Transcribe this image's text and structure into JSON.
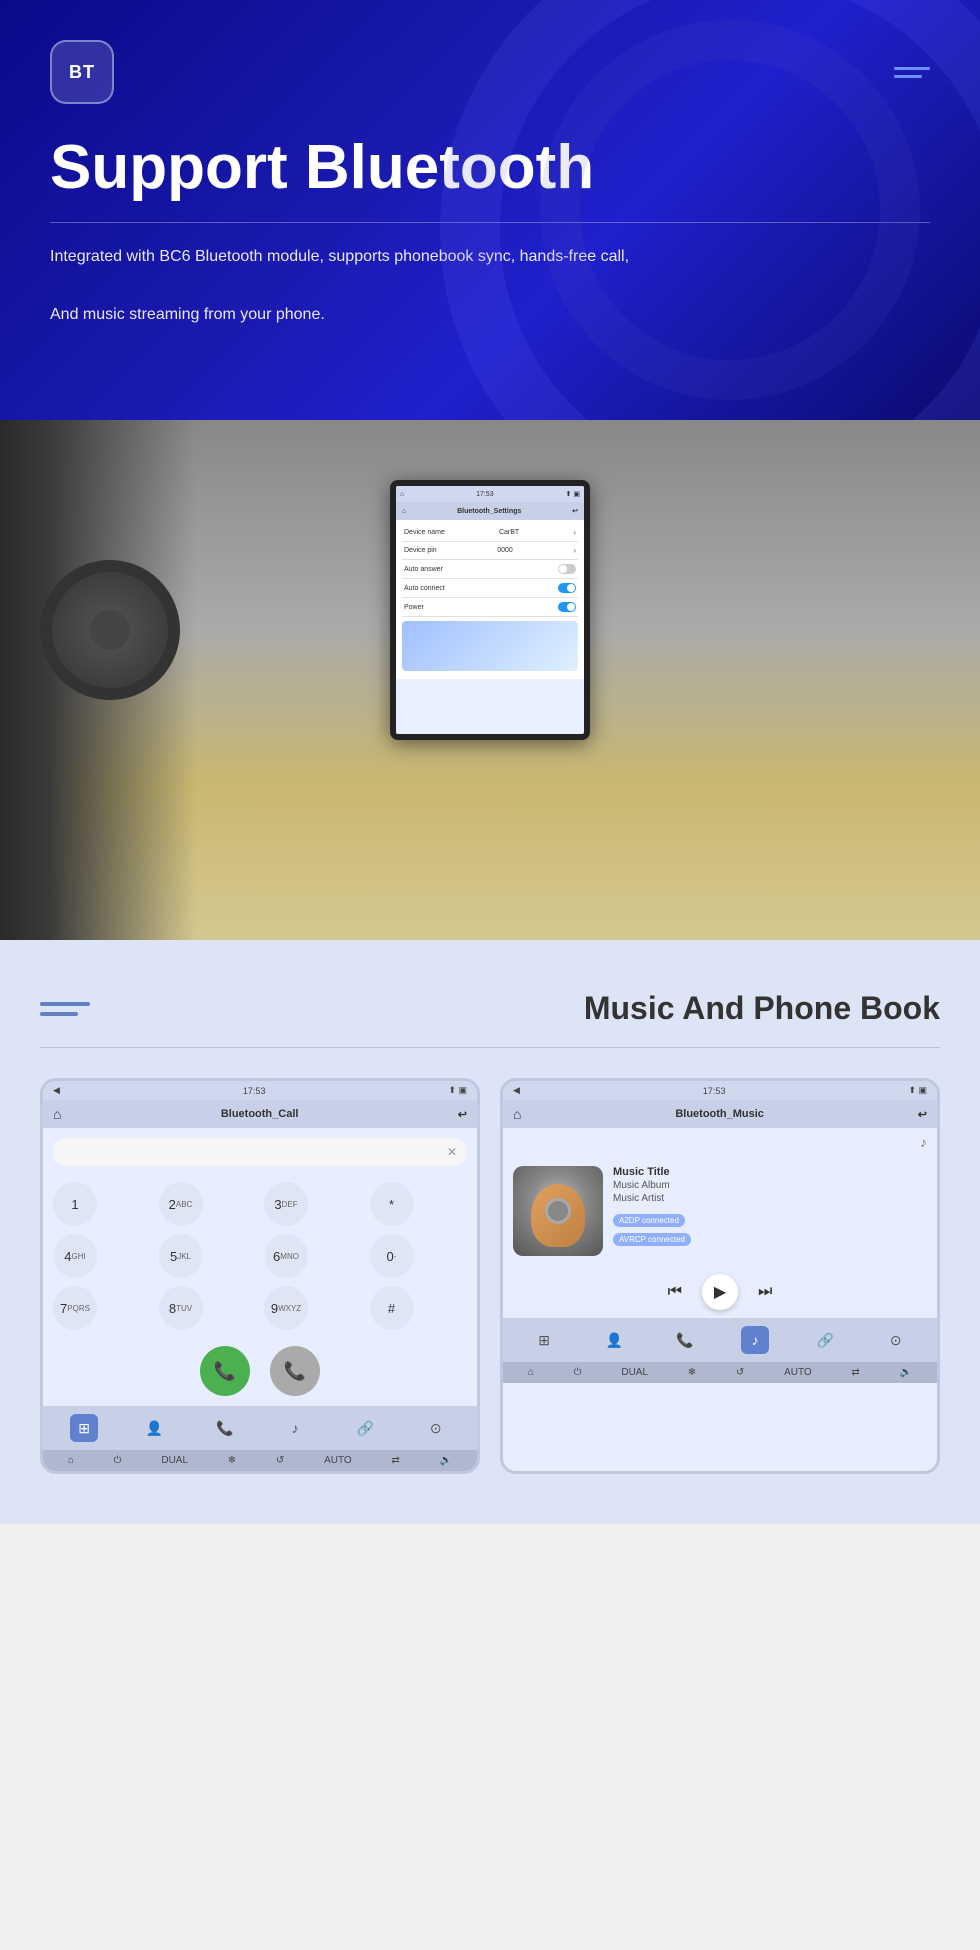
{
  "hero": {
    "bt_logo": "BT",
    "title": "Support Bluetooth",
    "description_line1": "Integrated with BC6 Bluetooth module, supports phonebook sync, hands-free call,",
    "description_line2": "And music streaming from your phone.",
    "menu_icon": "≡"
  },
  "car_screen": {
    "statusbar_time": "17:53",
    "title": "Bluetooth_Settings",
    "device_name_label": "Device name",
    "device_name_value": "CarBT",
    "device_pin_label": "Device pin",
    "device_pin_value": "0000",
    "auto_answer_label": "Auto answer",
    "auto_connect_label": "Auto connect",
    "power_label": "Power"
  },
  "music_phone_section": {
    "title": "Music And Phone Book",
    "call_screen": {
      "statusbar_time": "17:53",
      "title": "Bluetooth_Call",
      "dialpad": [
        {
          "label": "1",
          "sub": ""
        },
        {
          "label": "2",
          "sub": "ABC"
        },
        {
          "label": "3",
          "sub": "DEF"
        },
        {
          "label": "*",
          "sub": ""
        },
        {
          "label": "4",
          "sub": "GHI"
        },
        {
          "label": "5",
          "sub": "JKL"
        },
        {
          "label": "6",
          "sub": "MNO"
        },
        {
          "label": "0",
          "sub": "-"
        },
        {
          "label": "7",
          "sub": "PQRS"
        },
        {
          "label": "8",
          "sub": "TUV"
        },
        {
          "label": "9",
          "sub": "WXYZ"
        },
        {
          "label": "#",
          "sub": ""
        }
      ]
    },
    "music_screen": {
      "statusbar_time": "17:53",
      "title": "Bluetooth_Music",
      "music_title": "Music Title",
      "music_album": "Music Album",
      "music_artist": "Music Artist",
      "badge1": "A2DP connected",
      "badge2": "AVRCP connected"
    }
  }
}
